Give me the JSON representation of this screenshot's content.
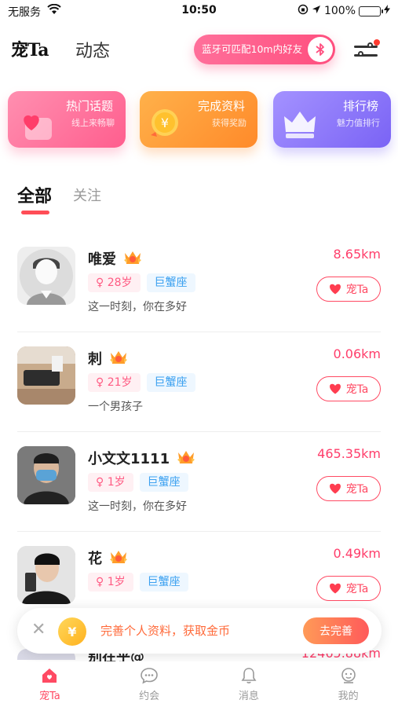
{
  "status_bar": {
    "carrier": "无服务",
    "time": "10:50",
    "battery": "100%",
    "battery_level": 1.0
  },
  "header": {
    "logo": "宠Ta",
    "tab_dynamic": "动态",
    "bluetooth_label": "蓝牙可匹配10m内好友"
  },
  "cards": [
    {
      "title": "热门话题",
      "subtitle": "线上来畅聊",
      "icon": "heart-icon"
    },
    {
      "title": "完成资料",
      "subtitle": "获得奖励",
      "icon": "coin-icon"
    },
    {
      "title": "排行榜",
      "subtitle": "魅力值排行",
      "icon": "crown-icon"
    }
  ],
  "tabs": {
    "all": "全部",
    "follow": "关注"
  },
  "users": [
    {
      "name": "唯爱",
      "age": "28岁",
      "zodiac": "巨蟹座",
      "signature": "这一时刻，你在多好",
      "distance": "8.65km",
      "action": "宠Ta"
    },
    {
      "name": "刺",
      "age": "21岁",
      "zodiac": "巨蟹座",
      "signature": "一个男孩子",
      "distance": "0.06km",
      "action": "宠Ta"
    },
    {
      "name": "小文文1111",
      "age": "1岁",
      "zodiac": "巨蟹座",
      "signature": "这一时刻，你在多好",
      "distance": "465.35km",
      "action": "宠Ta"
    },
    {
      "name": "花",
      "age": "1岁",
      "zodiac": "巨蟹座",
      "signature": "",
      "distance": "0.49km",
      "action": "宠Ta"
    }
  ],
  "peek_user": {
    "name": "别在乎@",
    "distance": "12465.88km"
  },
  "banner": {
    "coin_symbol": "¥",
    "text": "完善个人资料，获取金币",
    "button": "去完善"
  },
  "bottom_nav": [
    {
      "label": "宠Ta",
      "icon": "home-icon",
      "active": true
    },
    {
      "label": "约会",
      "icon": "chat-bubble-icon",
      "active": false
    },
    {
      "label": "消息",
      "icon": "bell-icon",
      "active": false
    },
    {
      "label": "我的",
      "icon": "profile-icon",
      "active": false
    }
  ],
  "colors": {
    "accent": "#ff4a63",
    "distance": "#ff3d6a",
    "zodiac": "#3aa0f0",
    "gender": "#ff5b83"
  }
}
